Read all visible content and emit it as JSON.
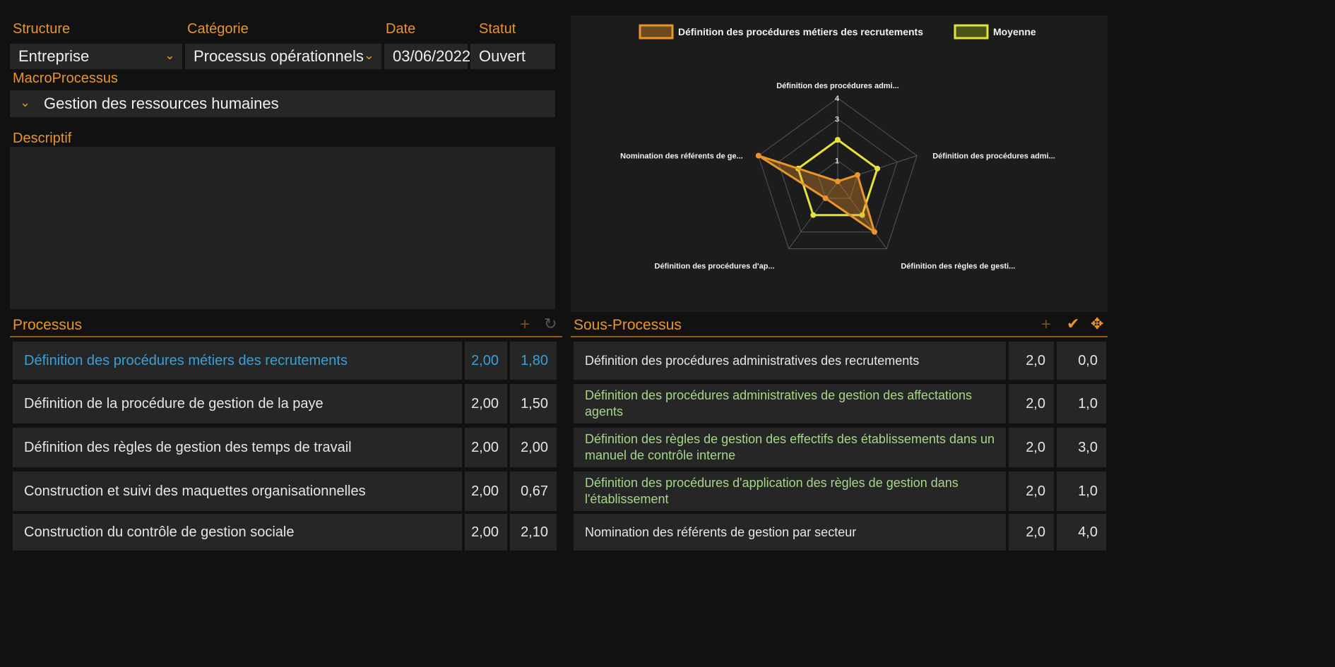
{
  "form": {
    "structure_label": "Structure",
    "structure_value": "Entreprise",
    "categorie_label": "Catégorie",
    "categorie_value": "Processus opérationnels",
    "date_label": "Date",
    "date_value": "03/06/2022",
    "statut_label": "Statut",
    "statut_value": "Ouvert",
    "macro_label": "MacroProcessus",
    "macro_value": "Gestion des ressources humaines",
    "descriptif_label": "Descriptif",
    "descriptif_value": ""
  },
  "processus": {
    "title": "Processus",
    "rows": [
      {
        "label": "Définition des procédures métiers des recrutements",
        "v1": "2,00",
        "v2": "1,80"
      },
      {
        "label": "Définition de la procédure de gestion de la paye",
        "v1": "2,00",
        "v2": "1,50"
      },
      {
        "label": "Définition des règles de gestion des temps de travail",
        "v1": "2,00",
        "v2": "2,00"
      },
      {
        "label": "Construction et suivi des maquettes organisationnelles",
        "v1": "2,00",
        "v2": "0,67"
      },
      {
        "label": "Construction du contrôle de gestion sociale",
        "v1": "2,00",
        "v2": "2,10"
      }
    ]
  },
  "sous_processus": {
    "title": "Sous-Processus",
    "rows": [
      {
        "label": "Définition des procédures administratives des recrutements",
        "v1": "2,0",
        "v2": "0,0"
      },
      {
        "label": "Définition des procédures administratives de gestion des affectations agents",
        "v1": "2,0",
        "v2": "1,0"
      },
      {
        "label": "Définition des règles de gestion des effectifs des établissements dans un manuel de contrôle interne",
        "v1": "2,0",
        "v2": "3,0"
      },
      {
        "label": "Définition des procédures d'application des règles de gestion dans l'établissement",
        "v1": "2,0",
        "v2": "1,0"
      },
      {
        "label": "Nomination des référents de gestion par secteur",
        "v1": "2,0",
        "v2": "4,0"
      }
    ]
  },
  "icons": {
    "chevron": "chevron-down-icon",
    "add": "plus-icon",
    "refresh": "refresh-icon",
    "check": "check-icon",
    "tool": "move-icon"
  },
  "colors": {
    "accent": "#e8952a",
    "series_main": "#e8952a",
    "series_avg": "#e6e23a",
    "active_link": "#3aa0d8",
    "sub_text": "#a6d68b"
  },
  "chart_data": {
    "type": "radar",
    "axes": [
      "Définition des procédures admi...",
      "Définition des procédures admi...",
      "Définition des règles de gesti...",
      "Définition des procédures d'ap...",
      "Nomination des référents de ge..."
    ],
    "ticks": [
      "1",
      "2",
      "3",
      "4"
    ],
    "rmax": 4,
    "legend_position": "top",
    "series": [
      {
        "name": "Définition des procédures métiers des recrutements",
        "values": [
          0,
          1,
          3,
          1,
          4
        ]
      },
      {
        "name": "Moyenne",
        "values": [
          2,
          2,
          2,
          2,
          2
        ]
      }
    ]
  }
}
